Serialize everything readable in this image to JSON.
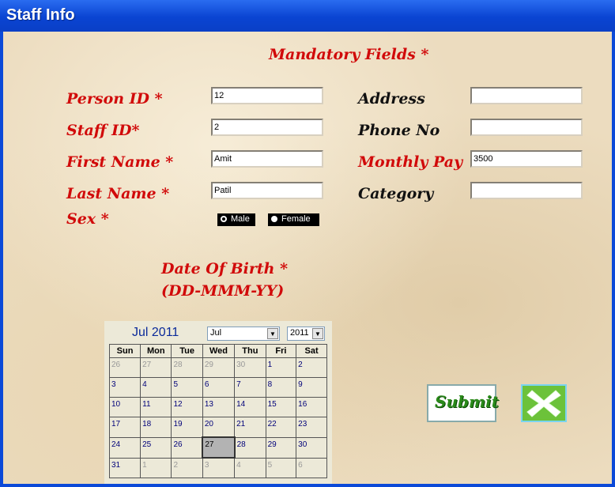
{
  "window": {
    "title": "Staff Info"
  },
  "form": {
    "mandatory_note": "Mandatory Fields *",
    "person_id_label": "Person ID *",
    "person_id_value": "12",
    "staff_id_label": "Staff ID*",
    "staff_id_value": "2",
    "first_name_label": "First Name *",
    "first_name_value": "Amit",
    "last_name_label": "Last Name *",
    "last_name_value": "Patil",
    "sex_label": "Sex *",
    "sex_options": [
      "Male",
      "Female"
    ],
    "sex_selected": "Male",
    "address_label": "Address",
    "address_value": "",
    "phone_label": "Phone No",
    "phone_value": "",
    "monthly_pay_label": "Monthly Pay",
    "monthly_pay_value": "3500",
    "category_label": "Category",
    "category_value": "",
    "dob_label": "Date Of Birth *",
    "dob_format": "(DD-MMM-YY)"
  },
  "calendar": {
    "header": "Jul 2011",
    "month_select": "Jul",
    "year_select": "2011",
    "weekdays": [
      "Sun",
      "Mon",
      "Tue",
      "Wed",
      "Thu",
      "Fri",
      "Sat"
    ],
    "weeks": [
      [
        "26",
        "27",
        "28",
        "29",
        "30",
        "1",
        "2"
      ],
      [
        "3",
        "4",
        "5",
        "6",
        "7",
        "8",
        "9"
      ],
      [
        "10",
        "11",
        "12",
        "13",
        "14",
        "15",
        "16"
      ],
      [
        "17",
        "18",
        "19",
        "20",
        "21",
        "22",
        "23"
      ],
      [
        "24",
        "25",
        "26",
        "27",
        "28",
        "29",
        "30"
      ],
      [
        "31",
        "1",
        "2",
        "3",
        "4",
        "5",
        "6"
      ]
    ],
    "selected_day": "27"
  },
  "buttons": {
    "submit_label": "Submit"
  }
}
